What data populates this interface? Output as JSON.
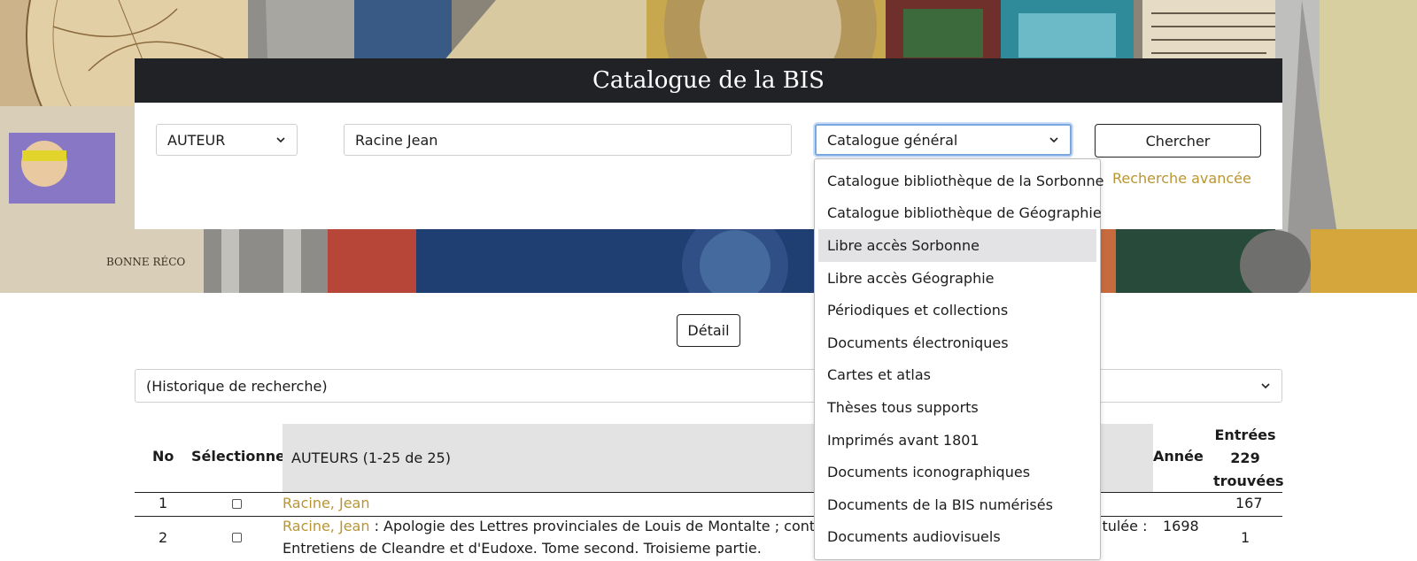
{
  "header": {
    "title": "Catalogue de la BIS"
  },
  "search": {
    "field_select": "AUTEUR",
    "query": "Racine Jean",
    "catalog_select": "Catalogue général",
    "search_button": "Chercher",
    "advanced_link": "Recherche avancée"
  },
  "catalog_dropdown": {
    "highlighted": "Libre accès Sorbonne",
    "options": [
      "Catalogue bibliothèque de la Sorbonne",
      "Catalogue bibliothèque de Géographie",
      "Libre accès Sorbonne",
      "Libre accès Géographie",
      "Périodiques et collections",
      "Documents électroniques",
      "Cartes et atlas",
      "Thèses tous supports",
      "Imprimés avant 1801",
      "Documents iconographiques",
      "Documents de la BIS numérisés",
      "Documents audiovisuels"
    ]
  },
  "detail_button": "Détail",
  "history_select": "(Historique de recherche)",
  "table": {
    "headers": {
      "no": "No",
      "select": "Sélectionner",
      "authors": "AUTEURS (1-25 de 25)",
      "year": "Année",
      "entries_line1": "Entrées",
      "entries_line2": "229",
      "entries_line3": "trouvées"
    },
    "rows": [
      {
        "no": "1",
        "author": "Racine, Jean",
        "title_a": "",
        "title_b": "",
        "title_c": "",
        "year": "",
        "entries": "167"
      },
      {
        "no": "2",
        "author": "Racine, Jean",
        "title_a": " : Apologie des Lettres provinciales de Louis de Montalte ; contr",
        "title_b": "itulée :",
        "title_c": "Entretiens de Cleandre et d'Eudoxe. Tome second. Troisieme partie.",
        "year": "1698",
        "entries": "1"
      }
    ]
  },
  "colors": {
    "accent_gold": "#b99532",
    "header_dark": "#212226",
    "focus_blue": "#7aa7e0"
  }
}
